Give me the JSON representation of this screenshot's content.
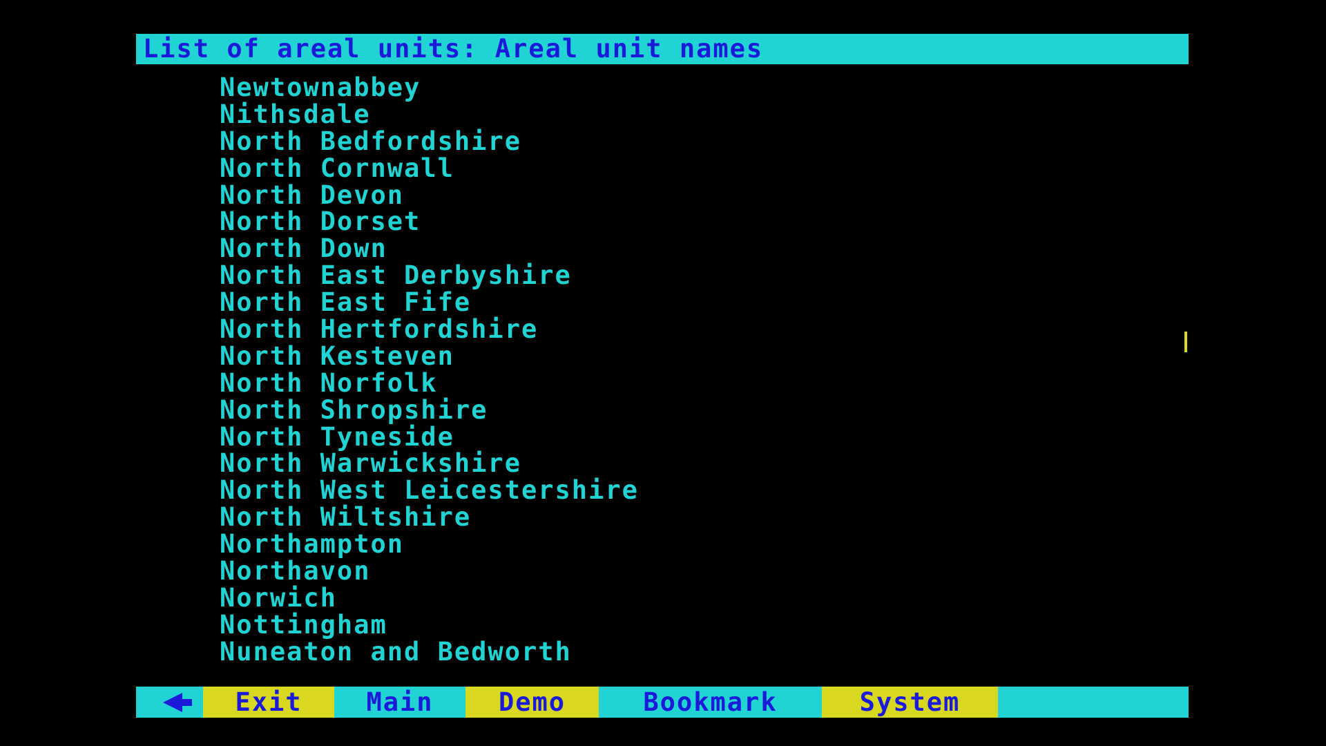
{
  "header": {
    "title": "List of areal units: Areal unit names"
  },
  "units": [
    "Newtownabbey",
    "Nithsdale",
    "North Bedfordshire",
    "North Cornwall",
    "North Devon",
    "North Dorset",
    "North Down",
    "North East Derbyshire",
    "North East Fife",
    "North Hertfordshire",
    "North Kesteven",
    "North Norfolk",
    "North Shropshire",
    "North Tyneside",
    "North Warwickshire",
    "North West Leicestershire",
    "North Wiltshire",
    "Northampton",
    "Northavon",
    "Norwich",
    "Nottingham",
    "Nuneaton and Bedworth"
  ],
  "footer": {
    "back_icon": "left-arrow-icon",
    "exit_label": "Exit",
    "main_label": "Main",
    "demo_label": "Demo",
    "bookmark_label": "Bookmark",
    "system_label": "System"
  },
  "colors": {
    "background": "#000000",
    "cyan": "#22d3d3",
    "blue": "#1a1ad8",
    "yellow": "#d8d820"
  }
}
